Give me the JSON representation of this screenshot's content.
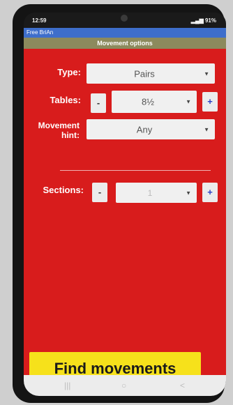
{
  "status_bar": {
    "time": "12:59",
    "battery": "91%"
  },
  "app": {
    "title": "Free BriAn",
    "header": "Movement options"
  },
  "form": {
    "type_label": "Type:",
    "type_value": "Pairs",
    "tables_label": "Tables:",
    "tables_value": "8½",
    "hint_label": "Movement hint:",
    "hint_value": "Any",
    "sections_label": "Sections:",
    "sections_value": "1",
    "minus": "-",
    "plus": "+"
  },
  "find_button": "Find movements",
  "nav": {
    "recents_icon": "|||",
    "home_icon": "○",
    "back_icon": "<"
  },
  "colors": {
    "background": "#d81c1c",
    "header": "#8c8a5d",
    "title_bar": "#3e6ecb",
    "find_button": "#f6e11b"
  }
}
